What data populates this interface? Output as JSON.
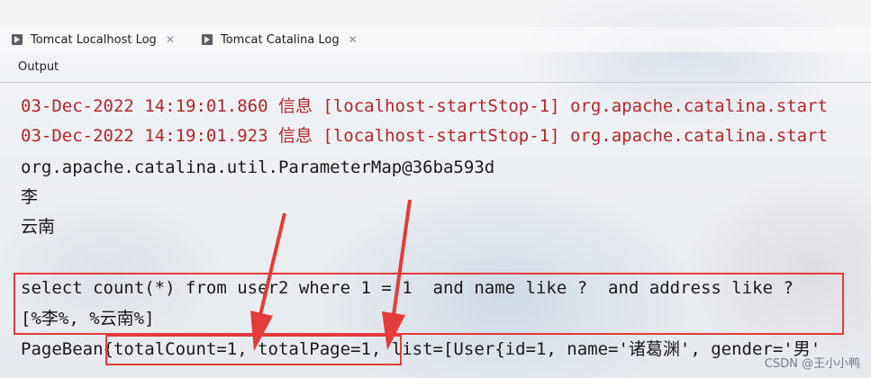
{
  "tabs": [
    {
      "label": "Tomcat Localhost Log",
      "icon": "play-icon"
    },
    {
      "label": "Tomcat Catalina Log",
      "icon": "play-icon"
    }
  ],
  "close_glyph": "✕",
  "output_label": "Output",
  "console": {
    "cut_line": "·  ·        ·       ·            ·",
    "lines": [
      "03-Dec-2022 14:19:01.860 信息 [localhost-startStop-1] org.apache.catalina.start",
      "03-Dec-2022 14:19:01.923 信息 [localhost-startStop-1] org.apache.catalina.start",
      "org.apache.catalina.util.ParameterMap@36ba593d",
      "李",
      "云南",
      "",
      "select count(*) from user2 where 1 = 1  and name like ?  and address like ?",
      "[%李%, %云南%]",
      "PageBean{totalCount=1, totalPage=1, list=[User{id=1, name='诸葛渊', gender='男'"
    ]
  },
  "colors": {
    "highlight": "#e33b3b",
    "error_text": "#b3262b"
  },
  "watermark": "CSDN @王小小鸭"
}
